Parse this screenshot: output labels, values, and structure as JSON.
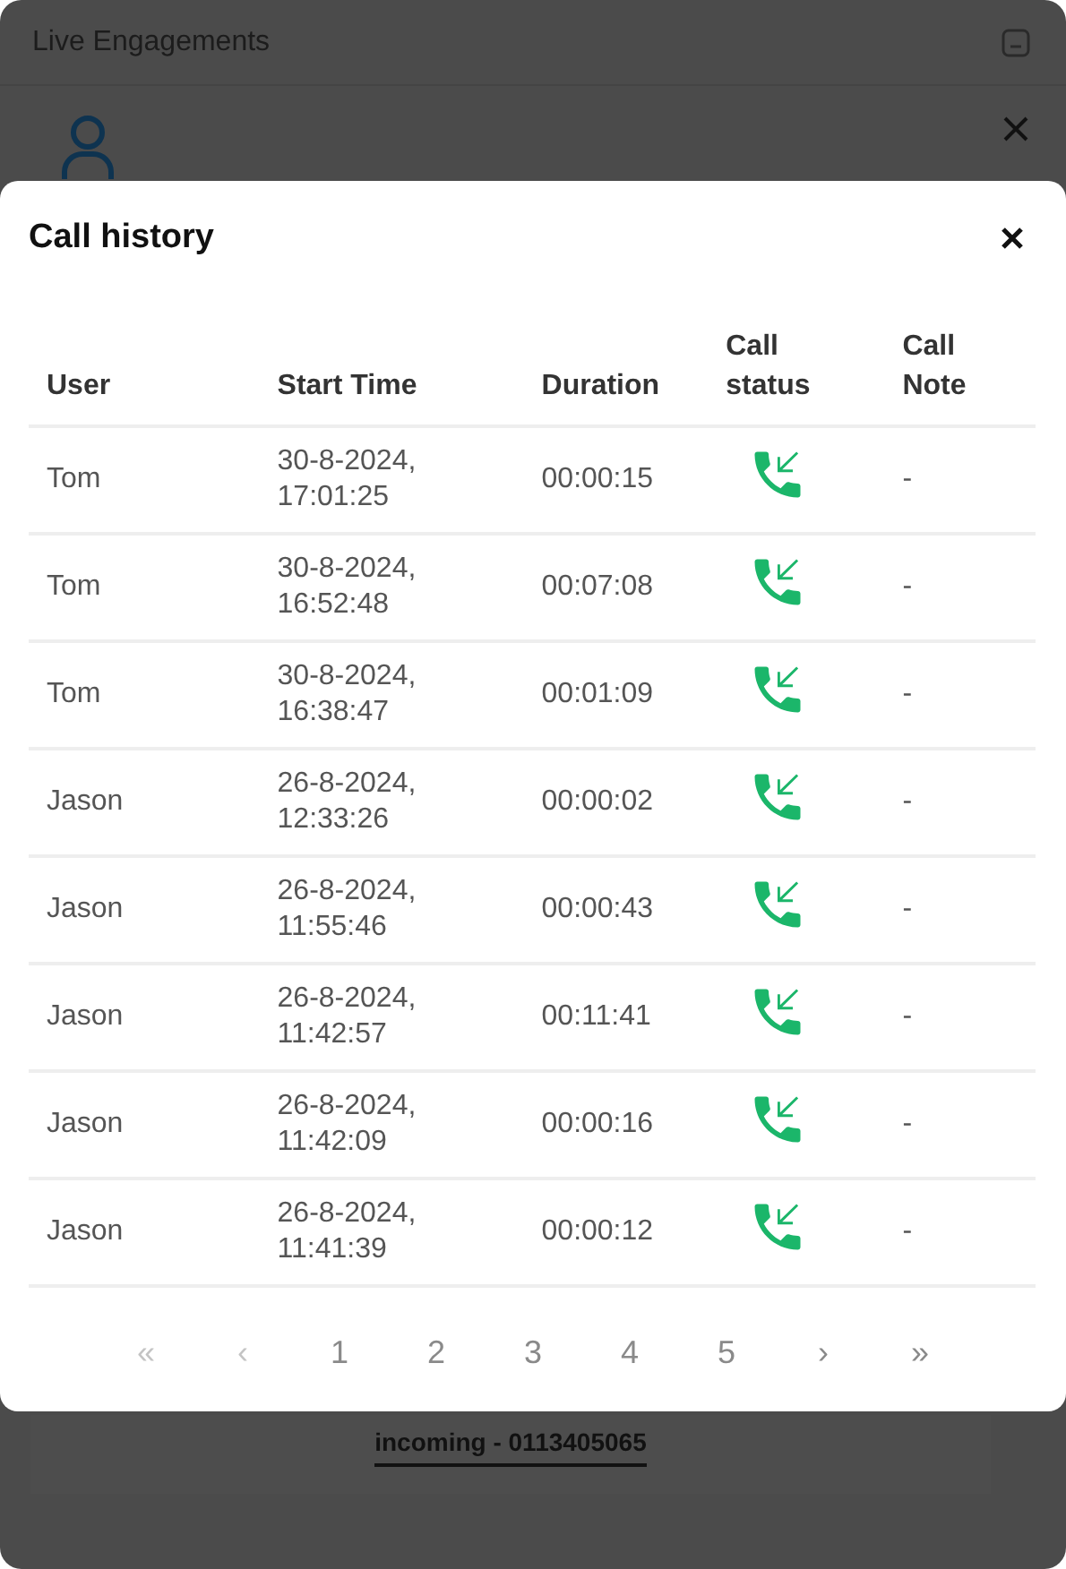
{
  "window": {
    "title": "Live Engagements"
  },
  "dialog": {
    "title": "Call history",
    "columns": [
      "User",
      "Start Time",
      "Duration",
      "Call status",
      "Call Note"
    ],
    "rows": [
      {
        "user": "Tom",
        "start": "30-8-2024, 17:01:25",
        "duration": "00:00:15",
        "incoming": true,
        "note": "-"
      },
      {
        "user": "Tom",
        "start": "30-8-2024, 16:52:48",
        "duration": "00:07:08",
        "incoming": true,
        "note": "-"
      },
      {
        "user": "Tom",
        "start": "30-8-2024, 16:38:47",
        "duration": "00:01:09",
        "incoming": true,
        "note": "-"
      },
      {
        "user": "Jason",
        "start": "26-8-2024, 12:33:26",
        "duration": "00:00:02",
        "incoming": true,
        "note": "-"
      },
      {
        "user": "Jason",
        "start": "26-8-2024, 11:55:46",
        "duration": "00:00:43",
        "incoming": true,
        "note": "-"
      },
      {
        "user": "Jason",
        "start": "26-8-2024, 11:42:57",
        "duration": "00:11:41",
        "incoming": true,
        "note": "-"
      },
      {
        "user": "Jason",
        "start": "26-8-2024, 11:42:09",
        "duration": "00:00:16",
        "incoming": true,
        "note": "-"
      },
      {
        "user": "Jason",
        "start": "26-8-2024, 11:41:39",
        "duration": "00:00:12",
        "incoming": true,
        "note": "-"
      }
    ],
    "pagination": [
      {
        "label": "«",
        "disabled": true
      },
      {
        "label": "‹",
        "disabled": true
      },
      {
        "label": "1",
        "disabled": false
      },
      {
        "label": "2",
        "disabled": false
      },
      {
        "label": "3",
        "disabled": false
      },
      {
        "label": "4",
        "disabled": false
      },
      {
        "label": "5",
        "disabled": false
      },
      {
        "label": "›",
        "disabled": false
      },
      {
        "label": "»",
        "disabled": false
      }
    ]
  },
  "call_link": "incoming - 0113405065"
}
